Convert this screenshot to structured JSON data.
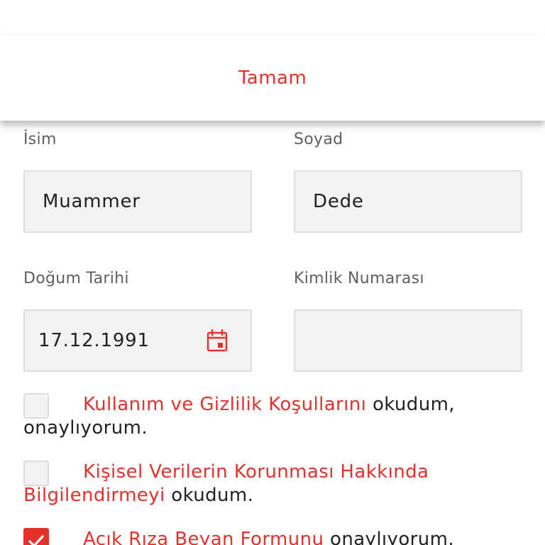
{
  "toolbar": {
    "done_label": "Tamam"
  },
  "form": {
    "first_name": {
      "label": "İsim",
      "value": "Muammer"
    },
    "last_name": {
      "label": "Soyad",
      "value": "Dede"
    },
    "birth_date": {
      "label": "Doğum Tarihi",
      "value": "17.12.1991",
      "icon": "calendar-icon"
    },
    "id_number": {
      "label": "Kimlik Numarası",
      "value": ""
    }
  },
  "consents": [
    {
      "link_text": "Kullanım ve Gizlilik Koşullarını",
      "rest_text": " okudum, onaylıyorum.",
      "checked": false
    },
    {
      "link_text": "Kişisel Verilerin Korunması Hakkında Bilgilendirmeyi",
      "rest_text": " okudum.",
      "checked": false
    },
    {
      "link_text": "Açık Rıza Beyan Formunu",
      "rest_text": " onaylıyorum.",
      "checked": true
    }
  ],
  "colors": {
    "accent": "#e4312b",
    "field_bg": "#f2f2f2",
    "label": "#5f5f5f"
  }
}
